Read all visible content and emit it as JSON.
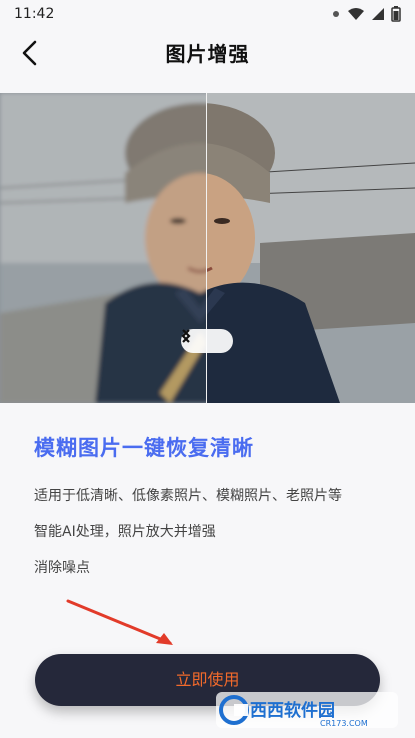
{
  "status_bar": {
    "time": "11:42"
  },
  "nav": {
    "title": "图片增强"
  },
  "headline": "模糊图片一键恢复清晰",
  "description": [
    "适用于低清晰、低像素照片、模糊照片、老照片等",
    "智能AI处理，照片放大并增强",
    "消除噪点"
  ],
  "cta": {
    "label": "立即使用"
  },
  "watermark": {
    "brand": "西西软件园",
    "site": "CR173.COM"
  },
  "colors": {
    "accent": "#4a6cf0",
    "cta_bg": "#25283a",
    "cta_text": "#f26a2b"
  }
}
